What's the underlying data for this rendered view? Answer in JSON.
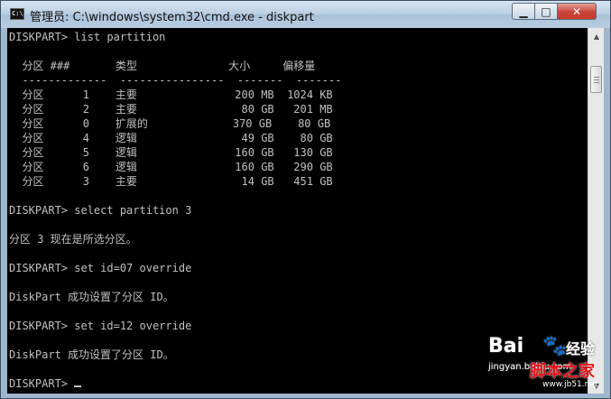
{
  "window": {
    "title": "管理员: C:\\windows\\system32\\cmd.exe - diskpart",
    "icon_label": "C:\\",
    "minimize_glyph": "▁",
    "maximize_glyph": "□",
    "close_glyph": "✕"
  },
  "console": {
    "lines": [
      "DISKPART> list partition",
      "",
      "  分区 ###       类型              大小     偏移量",
      "  -------------  ----------------  -------  -------",
      "  分区      1    主要               200 MB  1024 KB",
      "  分区      2    主要                80 GB   201 MB",
      "  分区      0    扩展的             370 GB    80 GB",
      "  分区      4    逻辑                49 GB    80 GB",
      "  分区      5    逻辑               160 GB   130 GB",
      "  分区      6    逻辑               160 GB   290 GB",
      "  分区      3    主要                14 GB   451 GB",
      "",
      "DISKPART> select partition 3",
      "",
      "分区 3 现在是所选分区。",
      "",
      "DISKPART> set id=07 override",
      "",
      "DiskPart 成功设置了分区 ID。",
      "",
      "DISKPART> set id=12 override",
      "",
      "DiskPart 成功设置了分区 ID。",
      ""
    ],
    "prompt": "DISKPART> "
  },
  "scrollbar": {
    "up_glyph": "▲",
    "down_glyph": "▼"
  },
  "watermark": {
    "brand": "Bai",
    "paw": "🐾",
    "jingyan": "经验",
    "url": "jingyan.baidu.com",
    "jb_brand": "脚本之家",
    "jb_url": "www.jb51.net"
  }
}
